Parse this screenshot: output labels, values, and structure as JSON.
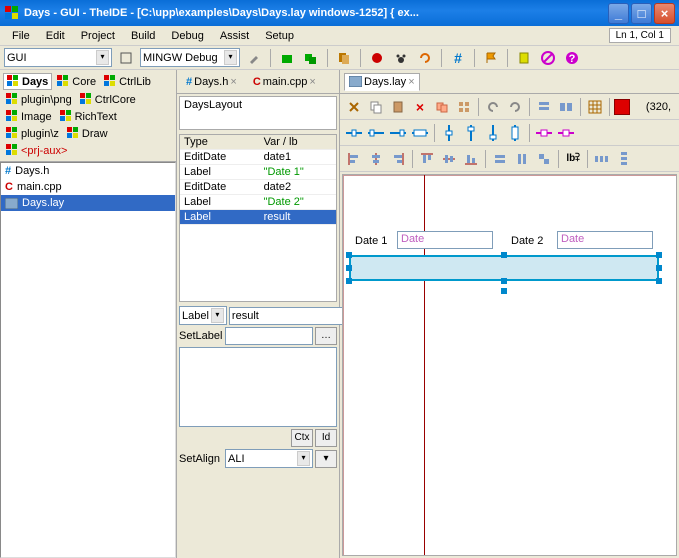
{
  "window": {
    "title": "Days - GUI - TheIDE - [C:\\upp\\examples\\Days\\Days.lay windows-1252] { ex..."
  },
  "menu": {
    "file": "File",
    "edit": "Edit",
    "project": "Project",
    "build": "Build",
    "debug": "Debug",
    "assist": "Assist",
    "setup": "Setup"
  },
  "cursor_pos": "Ln 1, Col 1",
  "combo1": "GUI",
  "combo2": "MINGW Debug",
  "packages": {
    "p0": "Days",
    "p1": "Core",
    "p2": "CtrlLib",
    "p3": "plugin\\png",
    "p4": "CtrlCore",
    "p5": "Image",
    "p6": "RichText",
    "p7": "plugin\\z",
    "p8": "Draw",
    "p9": "<prj-aux>"
  },
  "files": {
    "f0": "Days.h",
    "f1": "main.cpp",
    "f2": "Days.lay"
  },
  "tabs": {
    "t0": "Days.h",
    "t1": "main.cpp",
    "t2": "Days.lay"
  },
  "layout_name": "DaysLayout",
  "grid": {
    "h_type": "Type",
    "h_var": "Var / lb",
    "r0t": "EditDate",
    "r0v": "date1",
    "r1t": "Label",
    "r1v": "\"Date 1\"",
    "r2t": "EditDate",
    "r2v": "date2",
    "r3t": "Label",
    "r3v": "\"Date 2\"",
    "r4t": "Label",
    "r4v": "result"
  },
  "prop": {
    "type_sel": "Label",
    "var": "result",
    "setlabel_lbl": "SetLabel",
    "ctx": "Ctx",
    "id": "Id",
    "setalign_lbl": "SetAlign",
    "setalign_val": "ALI"
  },
  "designer": {
    "coords": "(320,",
    "lbl1": "Date 1",
    "ph1": "Date",
    "lbl2": "Date 2",
    "ph2": "Date"
  }
}
